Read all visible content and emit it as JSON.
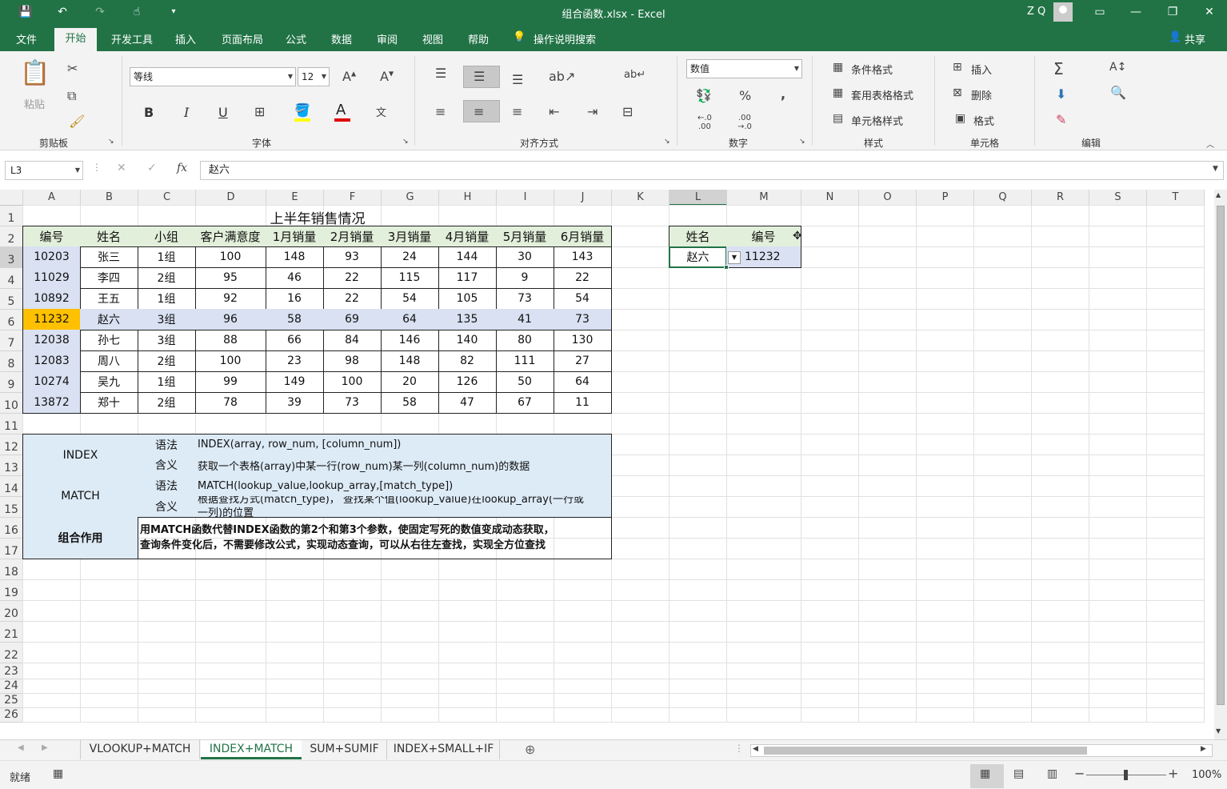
{
  "window": {
    "title": "组合函数.xlsx  -  Excel",
    "user": "Z Q"
  },
  "menu": {
    "tabs": [
      "文件",
      "开始",
      "开发工具",
      "插入",
      "页面布局",
      "公式",
      "数据",
      "审阅",
      "视图",
      "帮助"
    ],
    "tell_me": "操作说明搜索",
    "share": "共享",
    "active": "开始"
  },
  "ribbon": {
    "clipboard": {
      "paste": "粘贴",
      "label": "剪贴板"
    },
    "font": {
      "name": "等线",
      "size": "12",
      "label": "字体",
      "bold": "B",
      "italic": "I",
      "underline": "U"
    },
    "alignment": {
      "label": "对齐方式"
    },
    "number": {
      "format": "数值",
      "label": "数字"
    },
    "styles": {
      "conditional": "条件格式",
      "table": "套用表格格式",
      "cell": "单元格样式",
      "label": "样式"
    },
    "cells": {
      "insert": "插入",
      "delete": "删除",
      "format": "格式",
      "label": "单元格"
    },
    "editing": {
      "label": "编辑"
    }
  },
  "formula_bar": {
    "name_box": "L3",
    "value": "赵六"
  },
  "columns": [
    "A",
    "B",
    "C",
    "D",
    "E",
    "F",
    "G",
    "H",
    "I",
    "J",
    "K",
    "L",
    "M",
    "N",
    "O",
    "P",
    "Q",
    "R",
    "S",
    "T"
  ],
  "rows": [
    "1",
    "2",
    "3",
    "4",
    "5",
    "6",
    "7",
    "8",
    "9",
    "10",
    "11",
    "12",
    "13",
    "14",
    "15",
    "16",
    "17",
    "18",
    "19",
    "20",
    "21",
    "22",
    "23",
    "24",
    "25",
    "26"
  ],
  "sheet": {
    "title": "上半年销售情况",
    "headers": [
      "编号",
      "姓名",
      "小组",
      "客户满意度",
      "1月销量",
      "2月销量",
      "3月销量",
      "4月销量",
      "5月销量",
      "6月销量"
    ],
    "data": [
      [
        "10203",
        "张三",
        "1组",
        "100",
        "148",
        "93",
        "24",
        "144",
        "30",
        "143"
      ],
      [
        "11029",
        "李四",
        "2组",
        "95",
        "46",
        "22",
        "115",
        "117",
        "9",
        "22"
      ],
      [
        "10892",
        "王五",
        "1组",
        "92",
        "16",
        "22",
        "54",
        "105",
        "73",
        "54"
      ],
      [
        "11232",
        "赵六",
        "3组",
        "96",
        "58",
        "69",
        "64",
        "135",
        "41",
        "73"
      ],
      [
        "12038",
        "孙七",
        "3组",
        "88",
        "66",
        "84",
        "146",
        "140",
        "80",
        "130"
      ],
      [
        "12083",
        "周八",
        "2组",
        "100",
        "23",
        "98",
        "148",
        "82",
        "111",
        "27"
      ],
      [
        "10274",
        "吴九",
        "1组",
        "99",
        "149",
        "100",
        "20",
        "126",
        "50",
        "64"
      ],
      [
        "13872",
        "郑十",
        "2组",
        "78",
        "39",
        "73",
        "58",
        "47",
        "67",
        "11"
      ]
    ],
    "info": {
      "index_name": "INDEX",
      "match_name": "MATCH",
      "syntax_label": "语法",
      "meaning_label": "含义",
      "index_syntax": "INDEX(array, row_num, [column_num])",
      "index_meaning": "获取一个表格(array)中某一行(row_num)某一列(column_num)的数据",
      "match_syntax": "MATCH(lookup_value,lookup_array,[match_type])",
      "match_meaning_1": "根据查找方式(match_type)， 查找某个值(lookup_value)在lookup_array(一行或",
      "match_meaning_2": "一列)的位置",
      "combo_label": "组合作用",
      "combo_1": "用MATCH函数代替INDEX函数的第2个和第3个参数，使固定写死的数值变成动态获取，",
      "combo_2": "查询条件变化后，不需要修改公式，实现动态查询，可以从右往左查找，实现全方位查找"
    },
    "lookup": {
      "name_header": "姓名",
      "id_header": "编号",
      "name_value": "赵六",
      "id_value": "11232"
    }
  },
  "sheet_tabs": [
    "VLOOKUP+MATCH",
    "INDEX+MATCH",
    "SUM+SUMIF",
    "INDEX+SMALL+IF"
  ],
  "active_sheet": "INDEX+MATCH",
  "status": {
    "ready": "就绪",
    "zoom": "100%"
  },
  "colors": {
    "excel_green": "#217346",
    "header_fill": "#e2efda",
    "id_fill": "#d9e1f2",
    "highlight": "#ffc000",
    "info_fill": "#ddebf7"
  }
}
